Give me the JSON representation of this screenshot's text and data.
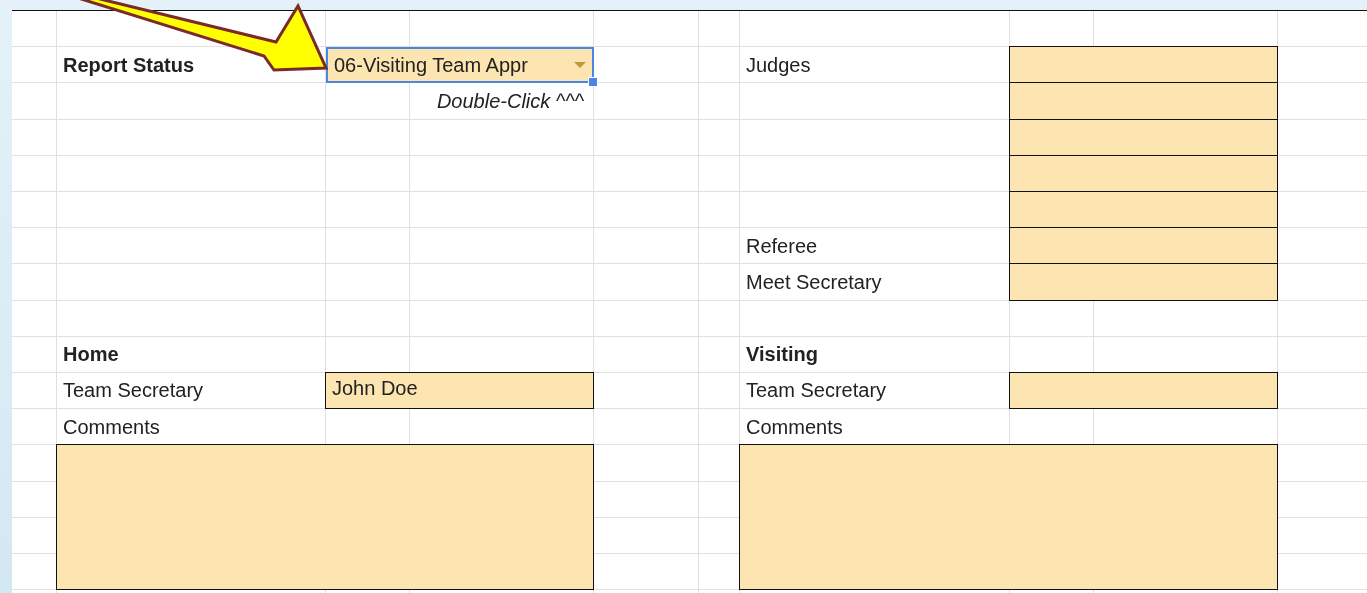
{
  "report_status": {
    "label": "Report Status",
    "value": "06-Visiting Team Appr",
    "selected": true,
    "hint": "Double-Click ^^^"
  },
  "officials": [
    {
      "kind": "labeled",
      "label": "Judges"
    },
    {
      "kind": "continuation"
    },
    {
      "kind": "continuation"
    },
    {
      "kind": "continuation"
    },
    {
      "kind": "continuation"
    },
    {
      "kind": "labeled",
      "label": "Referee"
    },
    {
      "kind": "labeled",
      "label": "Meet Secretary"
    }
  ],
  "teams": [
    {
      "heading": "Home",
      "secretary_label": "Team Secretary",
      "secretary": "John Doe",
      "comments_label": "Comments"
    },
    {
      "heading": "Visiting",
      "secretary_label": "Team Secretary",
      "comments_label": "Comments"
    }
  ]
}
